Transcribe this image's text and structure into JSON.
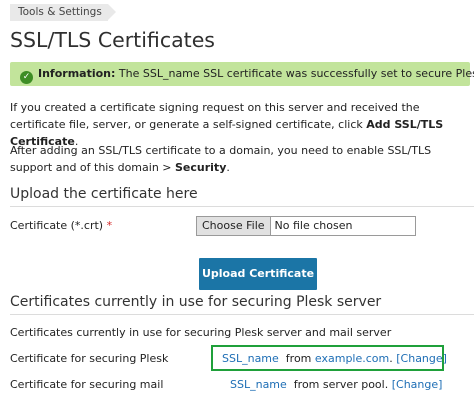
{
  "breadcrumb": "Tools & Settings",
  "page_title": "SSL/TLS Certificates",
  "message": {
    "prefix": "Information:",
    "text_before": "The",
    "cert_name": "SSL_name",
    "text_after": "SSL certificate was successfully set to secure Plesk."
  },
  "intro": {
    "p1_text": "If you created a certificate signing request on this server and received the certificate file, server, or generate a self-signed certificate, click",
    "p1_bold": "Add SSL/TLS Certificate",
    "p2_text": "After adding an SSL/TLS certificate to a domain, you need to enable SSL/TLS support and of this domain >",
    "p2_bold": "Security"
  },
  "upload_section": {
    "heading": "Upload the certificate here",
    "cert_label": "Certificate (*.crt)",
    "required_mark": "*",
    "choose_file": "Choose File",
    "no_file": "No file chosen",
    "upload_button": "Upload Certificate"
  },
  "in_use_section": {
    "heading": "Certificates currently in use for securing Plesk server",
    "row0_label": "Certificates currently in use for securing Plesk server and mail server",
    "plesk": {
      "label": "Certificate for securing Plesk",
      "cert": "SSL_name",
      "from": "from",
      "domain": "example.com",
      "change": "[Change]"
    },
    "mail": {
      "label": "Certificate for securing mail",
      "cert": "SSL_name",
      "from": "from server pool.",
      "change": "[Change]"
    }
  }
}
